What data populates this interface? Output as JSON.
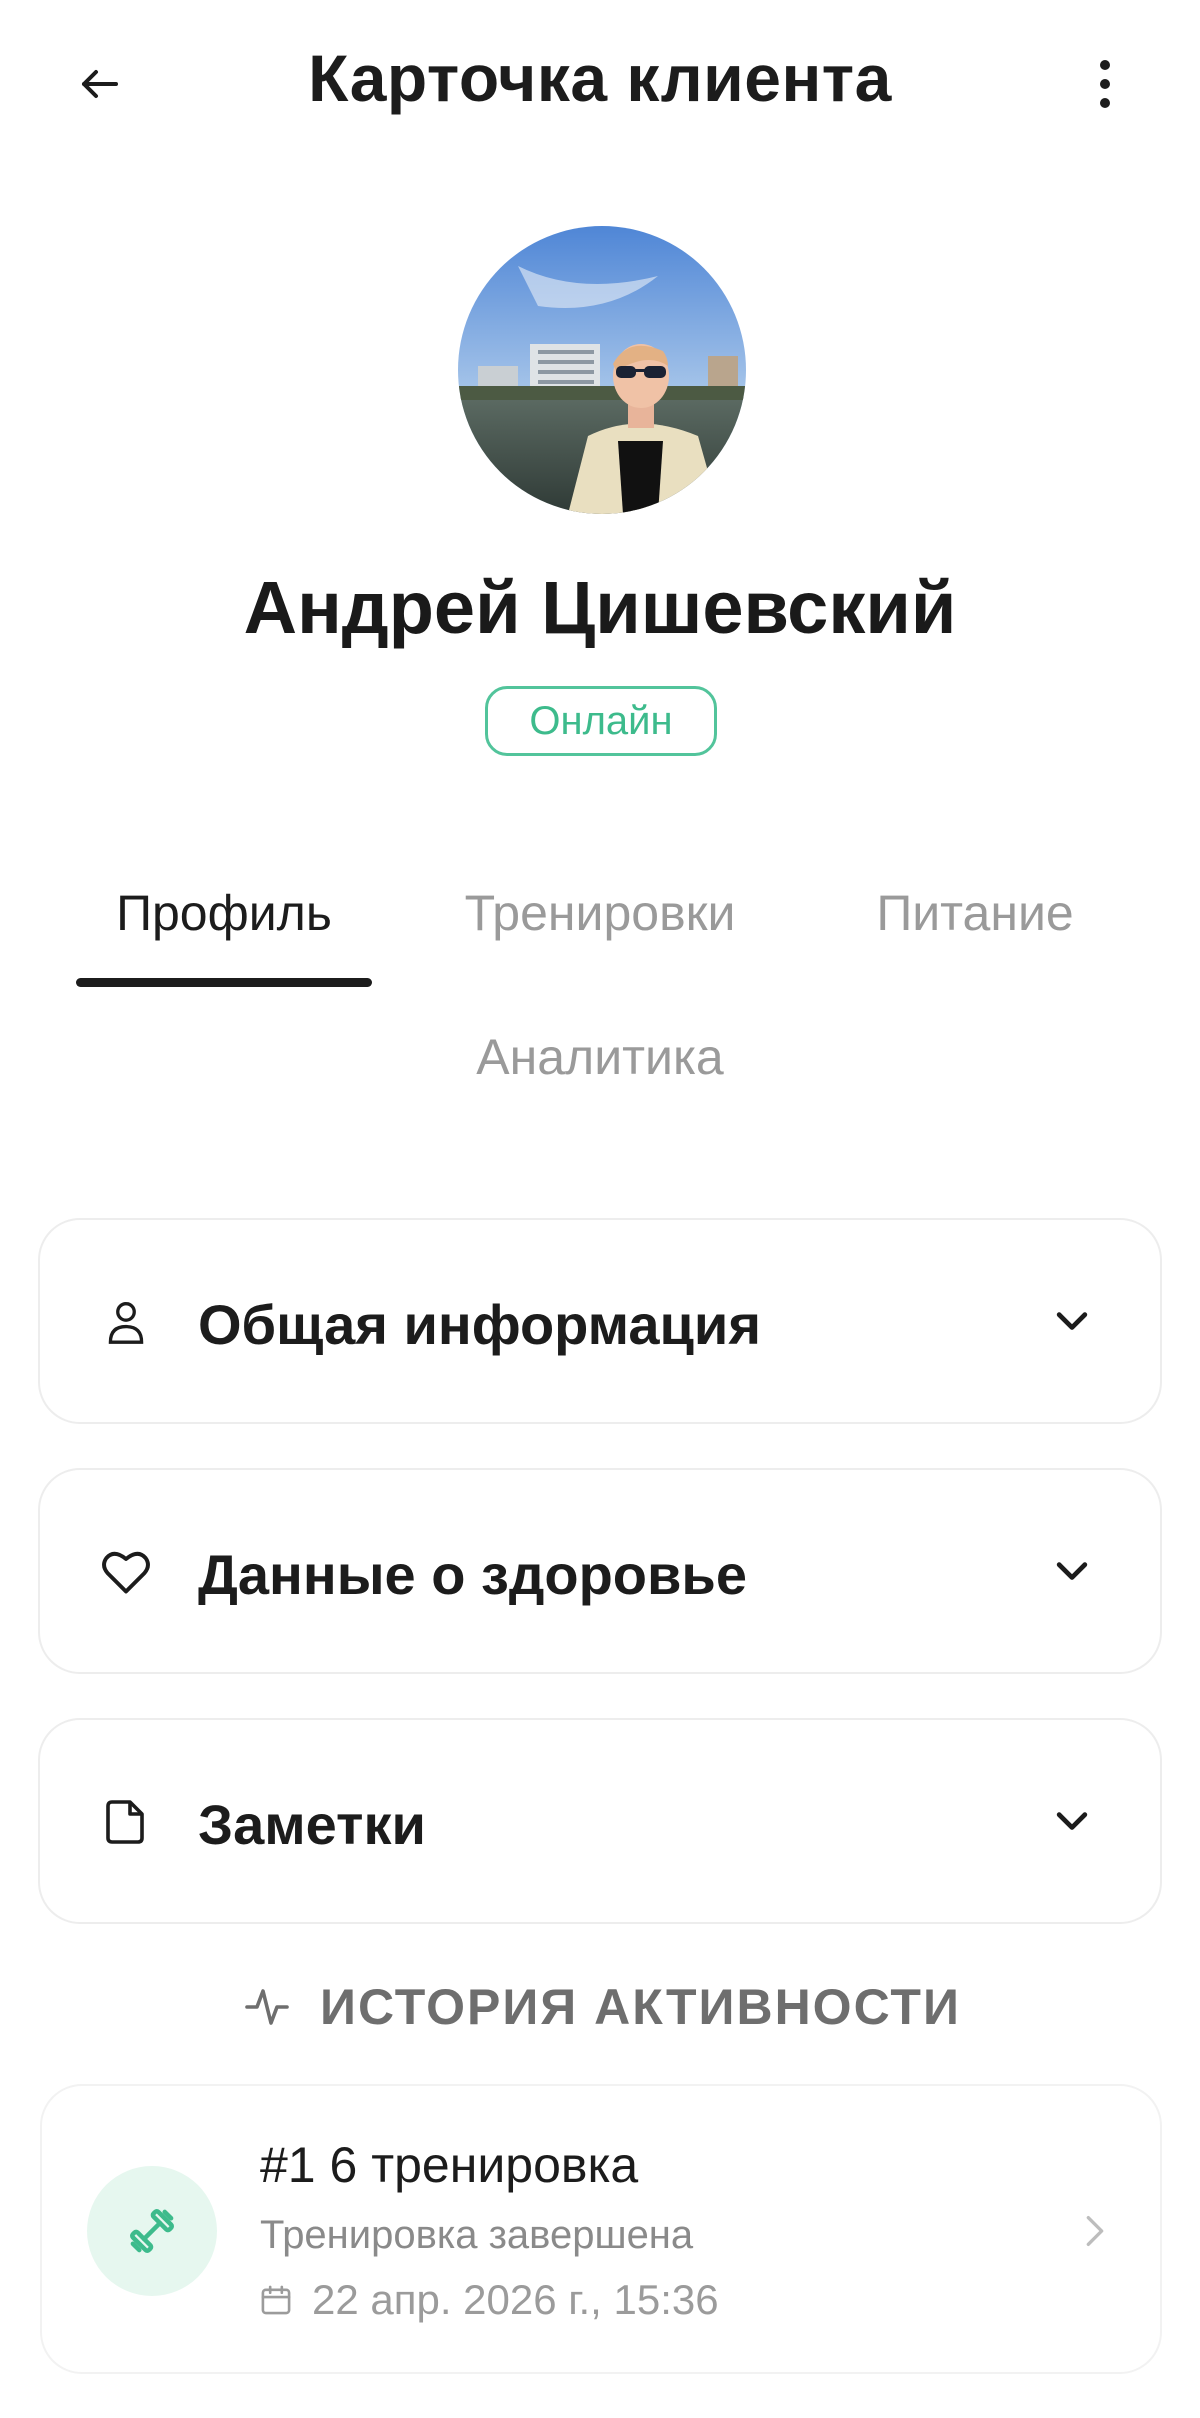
{
  "header": {
    "title": "Карточка клиента",
    "back_icon": "arrow-left-icon",
    "menu_icon": "more-vertical-icon"
  },
  "profile": {
    "name": "Андрей Цишевский",
    "status": "Онлайн",
    "status_color": "#3dbb8c"
  },
  "tabs": [
    {
      "label": "Профиль",
      "active": true
    },
    {
      "label": "Тренировки",
      "active": false
    },
    {
      "label": "Питание",
      "active": false
    },
    {
      "label": "Аналитика",
      "active": false
    }
  ],
  "sections": [
    {
      "title": "Общая информация",
      "icon": "user-icon"
    },
    {
      "title": "Данные о здоровье",
      "icon": "heart-icon"
    },
    {
      "title": "Заметки",
      "icon": "note-icon"
    }
  ],
  "history": {
    "title": "ИСТОРИЯ АКТИВНОСТИ",
    "icon": "activity-icon",
    "items": [
      {
        "title": "#1 6 тренировка",
        "subtitle": "Тренировка завершена",
        "date": "22 апр. 2026 г., 15:36",
        "icon": "dumbbell-icon"
      }
    ]
  },
  "colors": {
    "accent": "#3dbb8c",
    "accent_bg": "#e6f7ef",
    "text": "#1c1c1c",
    "muted": "#9a9a9a"
  }
}
